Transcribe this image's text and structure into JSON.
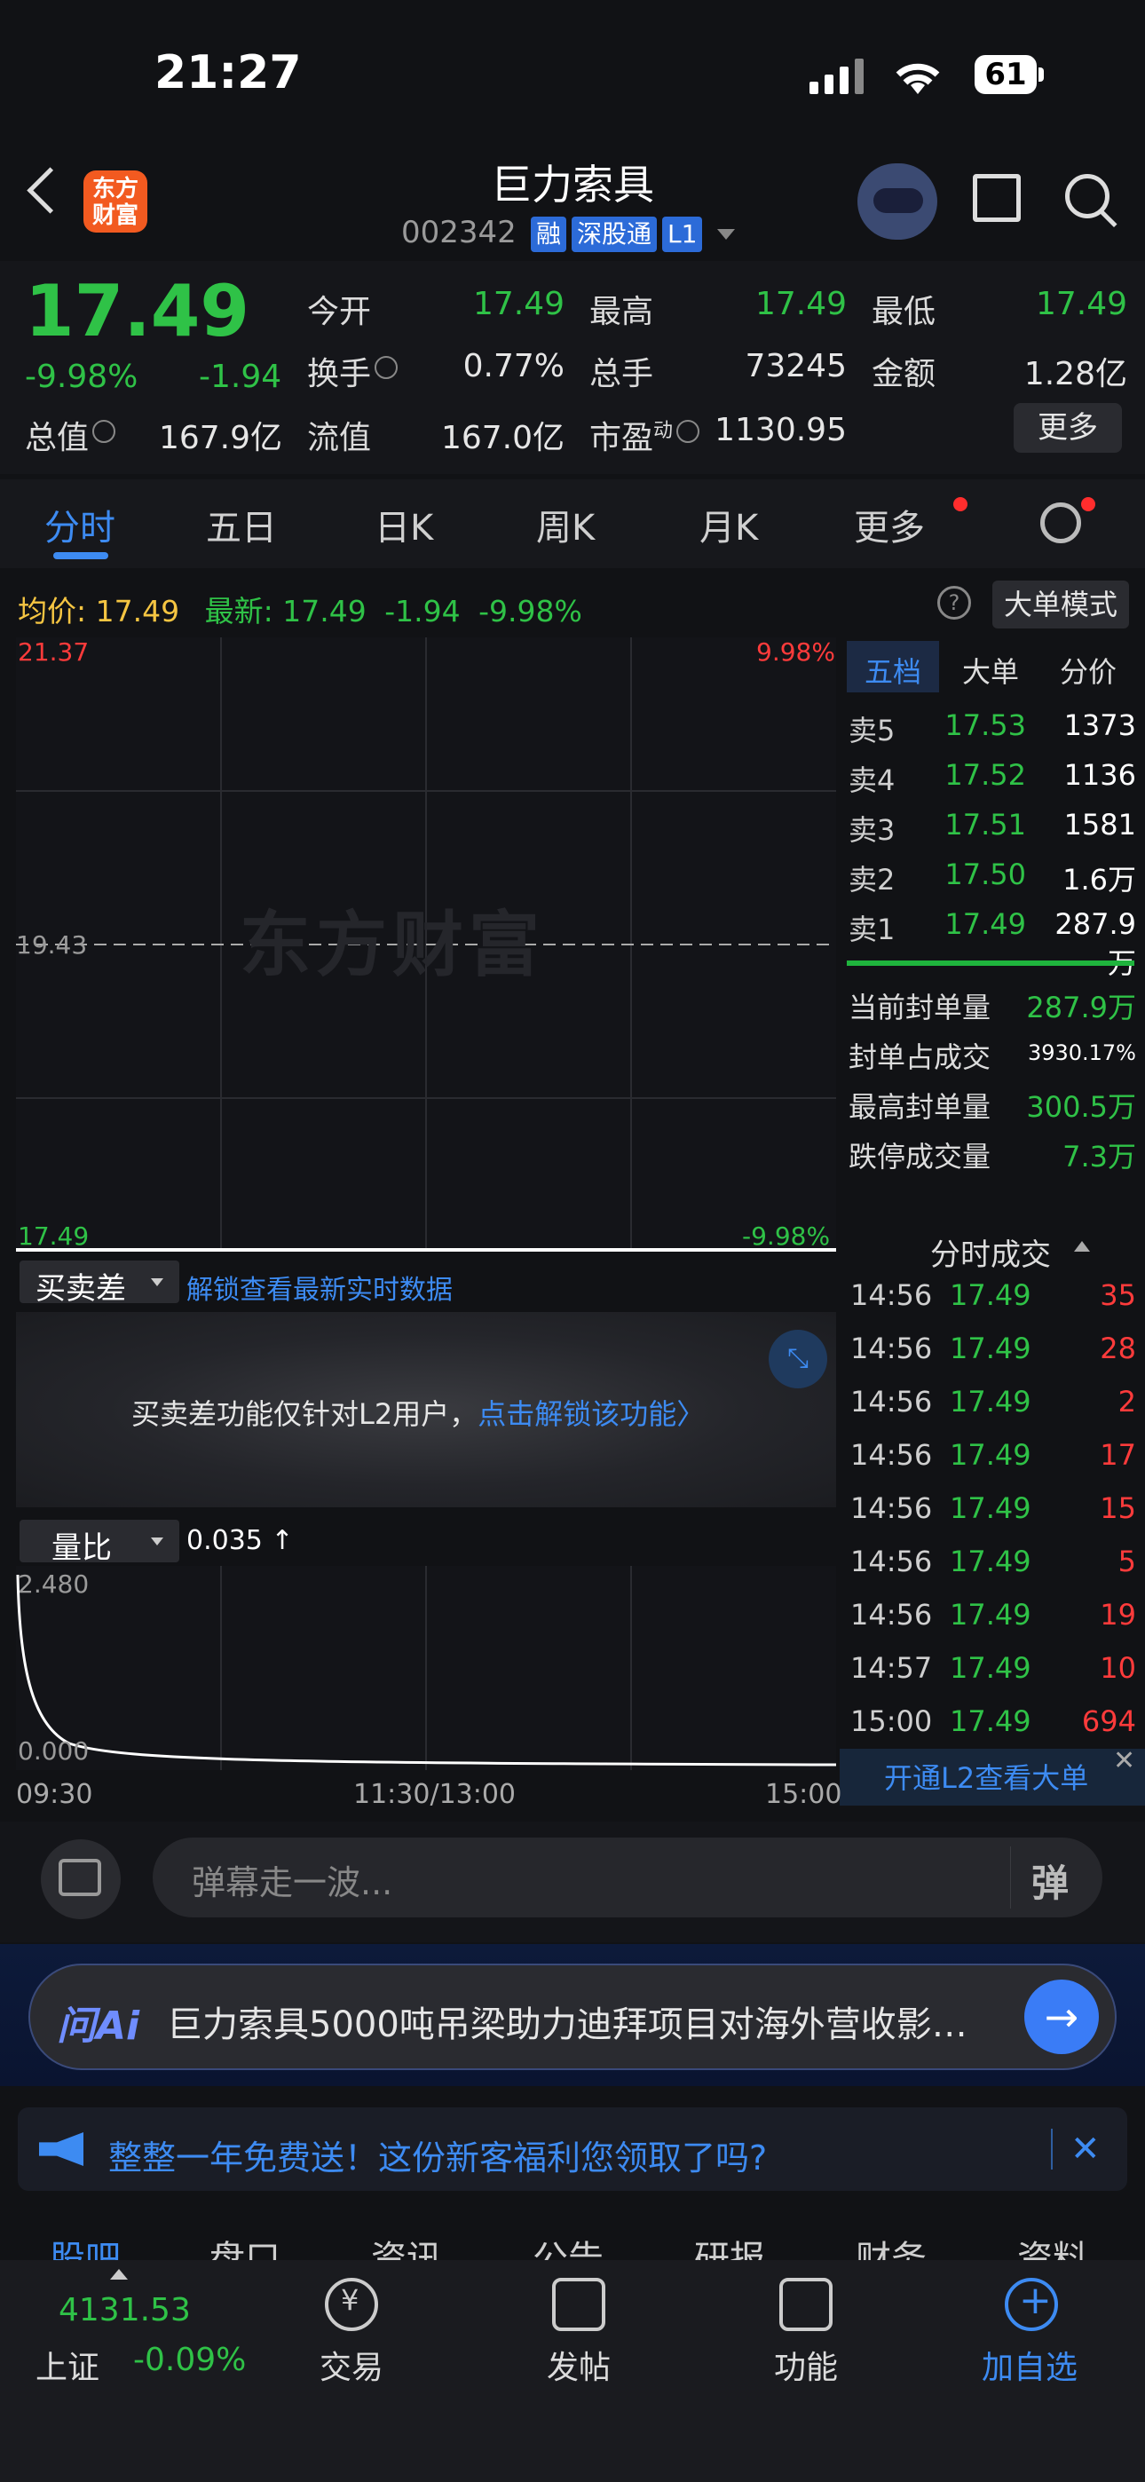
{
  "status_bar": {
    "time": "21:27",
    "battery": "61"
  },
  "header": {
    "logo_text": "东方\n财富",
    "stock_name": "巨力索具",
    "stock_code": "002342",
    "tags": [
      "融",
      "深股通",
      "L1"
    ]
  },
  "quote": {
    "price": "17.49",
    "change_pct": "-9.98%",
    "change": "-1.94",
    "fields": [
      {
        "label": "今开",
        "value": "17.49",
        "color": "green"
      },
      {
        "label": "最高",
        "value": "17.49",
        "color": "green"
      },
      {
        "label": "最低",
        "value": "17.49",
        "color": "green"
      },
      {
        "label": "换手",
        "value": "0.77%",
        "color": "white"
      },
      {
        "label": "总手",
        "value": "73245",
        "color": "white"
      },
      {
        "label": "金额",
        "value": "1.28亿",
        "color": "white"
      },
      {
        "label": "总值",
        "value": "167.9亿",
        "color": "white"
      },
      {
        "label": "流值",
        "value": "167.0亿",
        "color": "white"
      },
      {
        "label": "市盈",
        "value": "1130.95",
        "color": "white"
      }
    ],
    "pe_superscript": "动",
    "more_label": "更多"
  },
  "tabs": [
    "分时",
    "五日",
    "日K",
    "周K",
    "月K",
    "更多"
  ],
  "chart_header": {
    "avg_label": "均价:",
    "avg_value": "17.49",
    "latest_label": "最新:",
    "latest_value": "17.49",
    "latest_chg": "-1.94",
    "latest_pct": "-9.98%",
    "help": "?",
    "bigorder_label": "大单模式"
  },
  "chart_data": {
    "type": "line",
    "y_top": "21.37",
    "y_mid": "19.43",
    "y_bottom": "17.49",
    "pct_top": "9.98%",
    "pct_bottom": "-9.98%",
    "ylim": [
      17.49,
      21.37
    ],
    "watermark": "东方财富",
    "series": [
      {
        "values": [
          17.49,
          17.49
        ]
      }
    ]
  },
  "order_book": {
    "tabs": [
      "五档",
      "大单",
      "分价"
    ],
    "asks": [
      {
        "label": "卖5",
        "price": "17.53",
        "vol": "1373"
      },
      {
        "label": "卖4",
        "price": "17.52",
        "vol": "1136"
      },
      {
        "label": "卖3",
        "price": "17.51",
        "vol": "1581"
      },
      {
        "label": "卖2",
        "price": "17.50",
        "vol": "1.6万"
      },
      {
        "label": "卖1",
        "price": "17.49",
        "vol": "287.9万"
      }
    ],
    "seal": [
      {
        "label": "当前封单量",
        "value": "287.9万",
        "color": "green"
      },
      {
        "label": "封单占成交",
        "value": "3930.17%",
        "color": "white"
      },
      {
        "label": "最高封单量",
        "value": "300.5万",
        "color": "green"
      },
      {
        "label": "跌停成交量",
        "value": "7.3万",
        "color": "green"
      }
    ]
  },
  "ticks": {
    "title": "分时成交",
    "rows": [
      {
        "time": "14:56",
        "price": "17.49",
        "vol": "35"
      },
      {
        "time": "14:56",
        "price": "17.49",
        "vol": "28"
      },
      {
        "time": "14:56",
        "price": "17.49",
        "vol": "2"
      },
      {
        "time": "14:56",
        "price": "17.49",
        "vol": "17"
      },
      {
        "time": "14:56",
        "price": "17.49",
        "vol": "15"
      },
      {
        "time": "14:56",
        "price": "17.49",
        "vol": "5"
      },
      {
        "time": "14:56",
        "price": "17.49",
        "vol": "19"
      },
      {
        "time": "14:57",
        "price": "17.49",
        "vol": "10"
      },
      {
        "time": "15:00",
        "price": "17.49",
        "vol": "694"
      }
    ],
    "l2_banner": "开通L2查看大单",
    "close": "✕"
  },
  "spread": {
    "dropdown": "买卖差",
    "link": "解锁查看最新实时数据",
    "message": "买卖差功能仅针对L2用户，",
    "unlock": "点击解锁该功能〉"
  },
  "volume_ratio": {
    "dropdown": "量比",
    "value": "0.035 ↑",
    "y_top": "2.480",
    "y_bottom": "0.000",
    "times": [
      "09:30",
      "11:30/13:00",
      "15:00"
    ]
  },
  "danmaku": {
    "placeholder": "弹幕走一波...",
    "send": "弹"
  },
  "ai": {
    "logo": "问Ai",
    "text": "巨力索具5000吨吊梁助力迪拜项目对海外营收影…",
    "go": "→"
  },
  "promo": {
    "text": "整整一年免费送！这份新客福利您领取了吗?",
    "close": "✕"
  },
  "sub_tabs": [
    "股吧",
    "盘口",
    "资讯",
    "公告",
    "研报",
    "财务",
    "资料"
  ],
  "bottom_nav": {
    "index_value": "4131.53",
    "index_name": "上证",
    "index_pct": "-0.09%",
    "items": [
      "交易",
      "发帖",
      "功能",
      "加自选"
    ]
  }
}
